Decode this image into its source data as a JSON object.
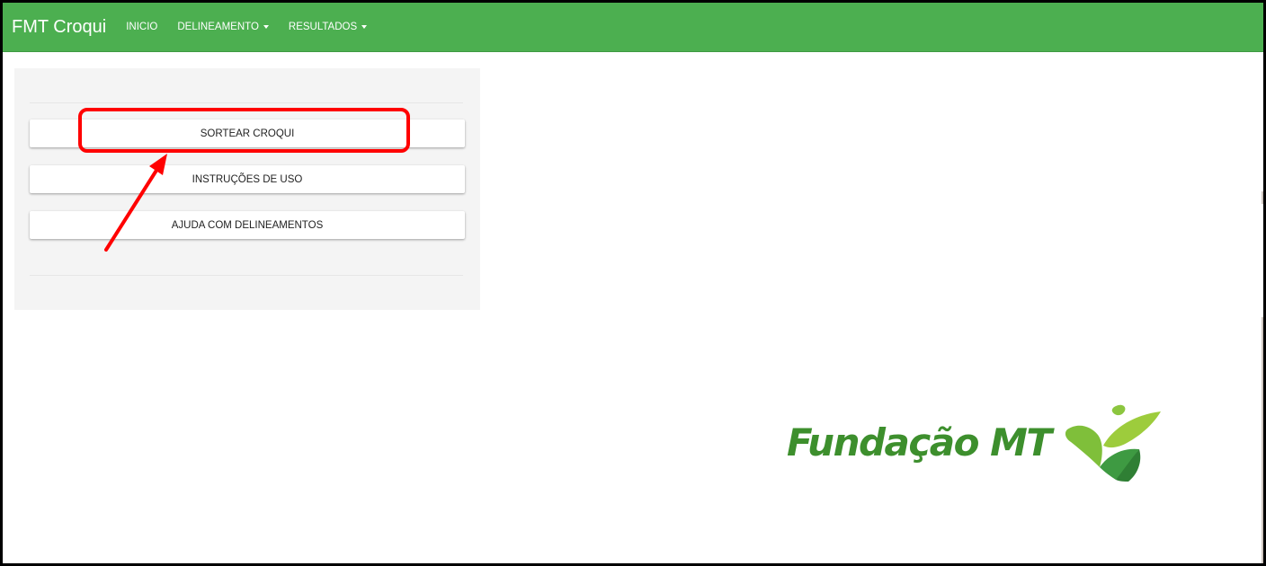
{
  "navbar": {
    "brand": "FMT Croqui",
    "items": [
      {
        "label": "INICIO",
        "dropdown": false
      },
      {
        "label": "DELINEAMENTO",
        "dropdown": true
      },
      {
        "label": "RESULTADOS",
        "dropdown": true
      }
    ],
    "bg_color": "#4caf50"
  },
  "panel": {
    "buttons": [
      {
        "label": "SORTEAR CROQUI"
      },
      {
        "label": "INSTRUÇÕES DE USO"
      },
      {
        "label": "AJUDA COM DELINEAMENTOS"
      }
    ]
  },
  "annotation": {
    "color": "#ff0000",
    "target": "SORTEAR CROQUI"
  },
  "logo": {
    "text": "Fundação MT",
    "color": "#3d8f2d",
    "accent_color": "#8cc63f"
  }
}
